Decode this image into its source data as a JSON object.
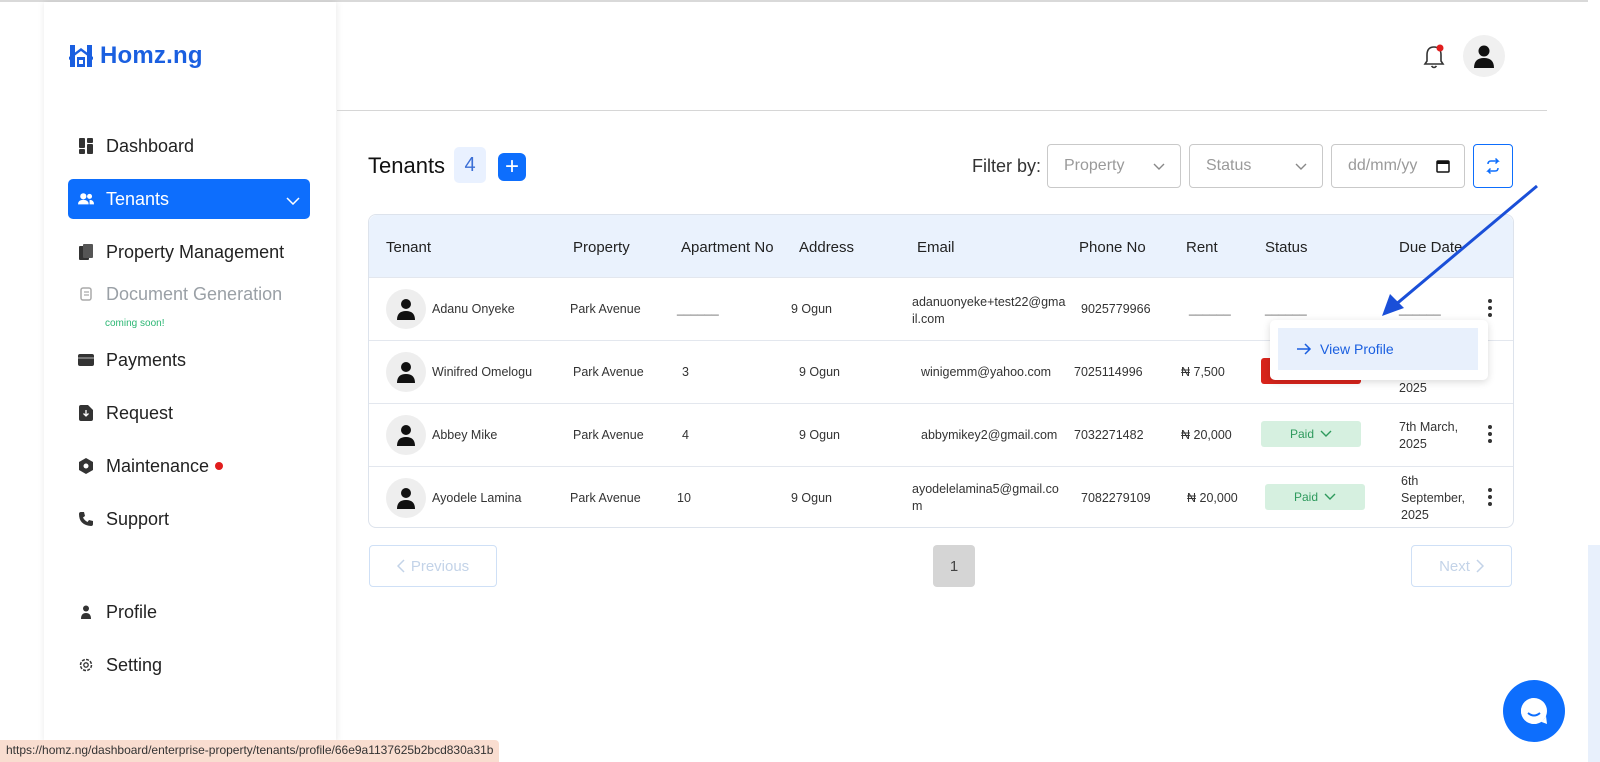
{
  "brand": {
    "name": "Homz.ng"
  },
  "sidebar": {
    "items": [
      {
        "label": "Dashboard",
        "icon": "dashboard-icon"
      },
      {
        "label": "Tenants",
        "icon": "users-icon"
      },
      {
        "label": "Property Management",
        "icon": "building-icon"
      },
      {
        "label": "Document Generation",
        "icon": "document-icon"
      },
      {
        "label": "Payments",
        "icon": "wallet-icon"
      },
      {
        "label": "Request",
        "icon": "request-icon"
      },
      {
        "label": "Maintenance",
        "icon": "maintenance-icon"
      },
      {
        "label": "Support",
        "icon": "phone-icon"
      },
      {
        "label": "Profile",
        "icon": "person-icon"
      },
      {
        "label": "Setting",
        "icon": "gear-icon"
      }
    ],
    "coming_soon": "coming soon!"
  },
  "page": {
    "title": "Tenants",
    "count": "4",
    "add_label": "+"
  },
  "filters": {
    "label": "Filter by:",
    "property_placeholder": "Property",
    "status_placeholder": "Status",
    "date_placeholder": "dd/mm/yy"
  },
  "table": {
    "headers": [
      "Tenant",
      "Property",
      "Apartment No",
      "Address",
      "Email",
      "Phone No",
      "Rent",
      "Status",
      "Due Date"
    ],
    "rows": [
      {
        "tenant": "Adanu Onyeke",
        "property": "Park Avenue",
        "apartment": "______",
        "address": "9 Ogun",
        "email": "adanuonyeke+test22@gmail.com",
        "email_l1": "adanuonyeke+test22@gma",
        "email_l2": "il.com",
        "phone": "9025779966",
        "rent": "______",
        "status": "______",
        "due_date": "______"
      },
      {
        "tenant": "Winifred Omelogu",
        "property": "Park Avenue",
        "apartment": "3",
        "address": "9 Ogun",
        "email": "winigemm@yahoo.com",
        "phone": "7025114996",
        "rent": "₦ 7,500",
        "status": "",
        "due_date": "2025"
      },
      {
        "tenant": "Abbey Mike",
        "property": "Park Avenue",
        "apartment": "4",
        "address": "9 Ogun",
        "email": "abbymikey2@gmail.com",
        "phone": "7032271482",
        "rent": "₦ 20,000",
        "status": "Paid",
        "due_l1": "7th March,",
        "due_l2": "2025"
      },
      {
        "tenant": "Ayodele Lamina",
        "property": "Park Avenue",
        "apartment": "10",
        "address": "9 Ogun",
        "email_l1": "ayodelelamina5@gmail.co",
        "email_l2": "m",
        "phone": "7082279109",
        "rent": "₦ 20,000",
        "status": "Paid",
        "due_l1": "6th",
        "due_l2": "September,",
        "due_l3": "2025"
      }
    ]
  },
  "popup": {
    "view_profile": "View Profile"
  },
  "pagination": {
    "previous": "Previous",
    "next": "Next",
    "current": "1"
  },
  "status_bar": {
    "url": "https://homz.ng/dashboard/enterprise-property/tenants/profile/66e9a1137625b2bcd830a31b"
  },
  "colors": {
    "primary": "#0d6efd",
    "paid_bg": "#d6f0e0",
    "paid_text": "#2e9a5d",
    "unpaid": "#d8241b"
  }
}
